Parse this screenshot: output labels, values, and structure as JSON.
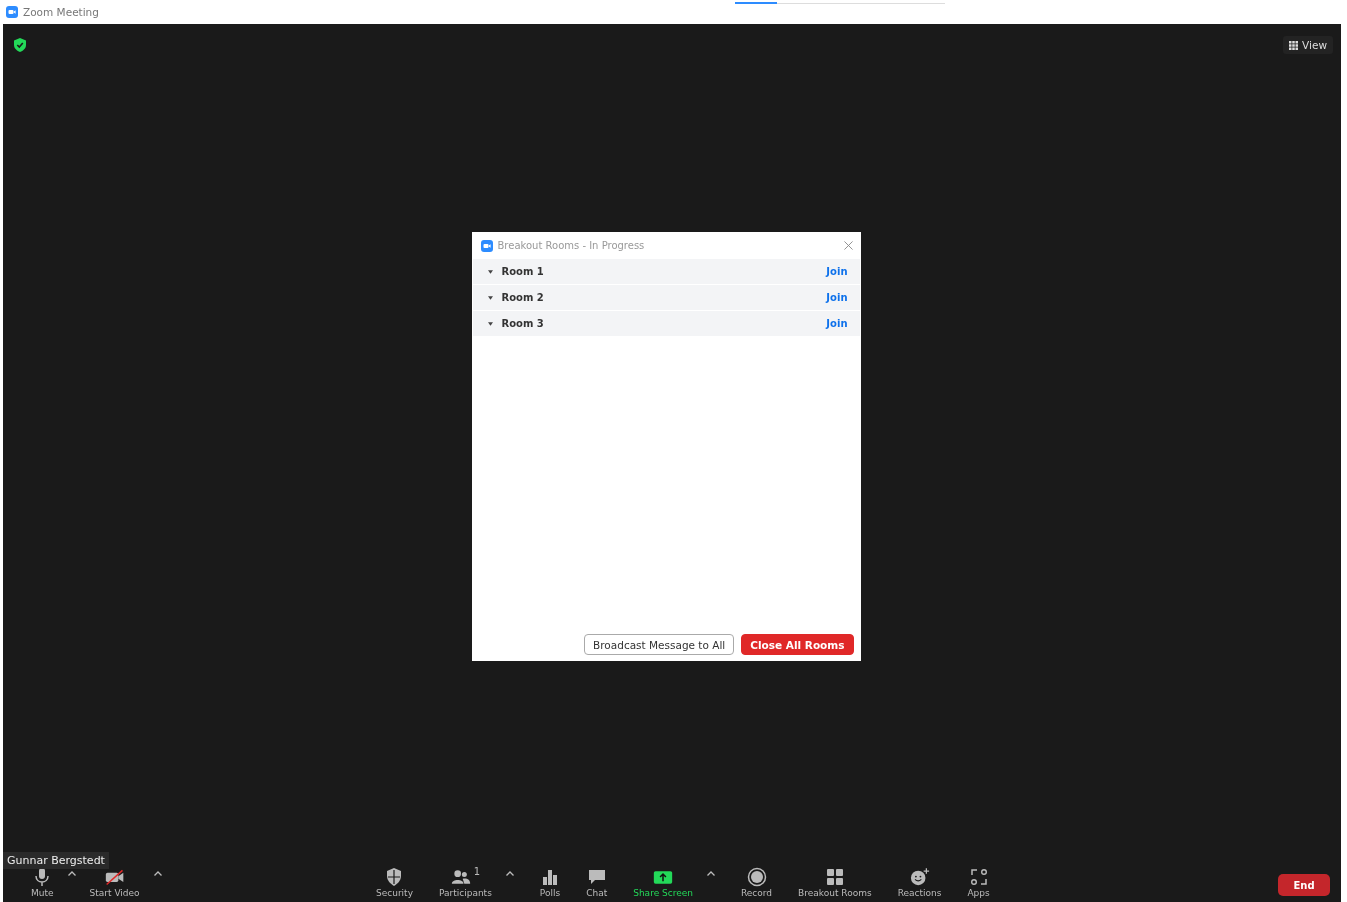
{
  "window": {
    "title": "Zoom Meeting"
  },
  "top_bar": {
    "view_button": "View"
  },
  "participant_name": "Gunnar Bergstedt",
  "dialog": {
    "title": "Breakout Rooms - In Progress",
    "rooms": [
      {
        "name": "Room 1",
        "action": "Join"
      },
      {
        "name": "Room 2",
        "action": "Join"
      },
      {
        "name": "Room 3",
        "action": "Join"
      }
    ],
    "buttons": [
      {
        "label": "Broadcast Message to All",
        "kind": "secondary"
      },
      {
        "label": "Close All Rooms",
        "kind": "primary"
      }
    ]
  },
  "toolbar": {
    "left": [
      {
        "kind": "mic",
        "label": "Mute",
        "menu": true
      },
      {
        "kind": "video_off",
        "label": "Start Video",
        "menu": true
      }
    ],
    "center": [
      {
        "kind": "security",
        "label": "Security",
        "menu": false
      },
      {
        "kind": "participants",
        "label": "Participants",
        "count": "1",
        "menu": true
      },
      {
        "kind": "polls",
        "label": "Polls",
        "menu": false
      },
      {
        "kind": "chat",
        "label": "Chat",
        "menu": false
      },
      {
        "kind": "share",
        "label": "Share Screen",
        "menu": true
      },
      {
        "kind": "record",
        "label": "Record",
        "menu": false
      },
      {
        "kind": "breakout",
        "label": "Breakout Rooms",
        "menu": false
      },
      {
        "kind": "reactions",
        "label": "Reactions",
        "menu": false
      },
      {
        "kind": "apps",
        "label": "Apps",
        "menu": false
      }
    ],
    "end_button": "End"
  }
}
